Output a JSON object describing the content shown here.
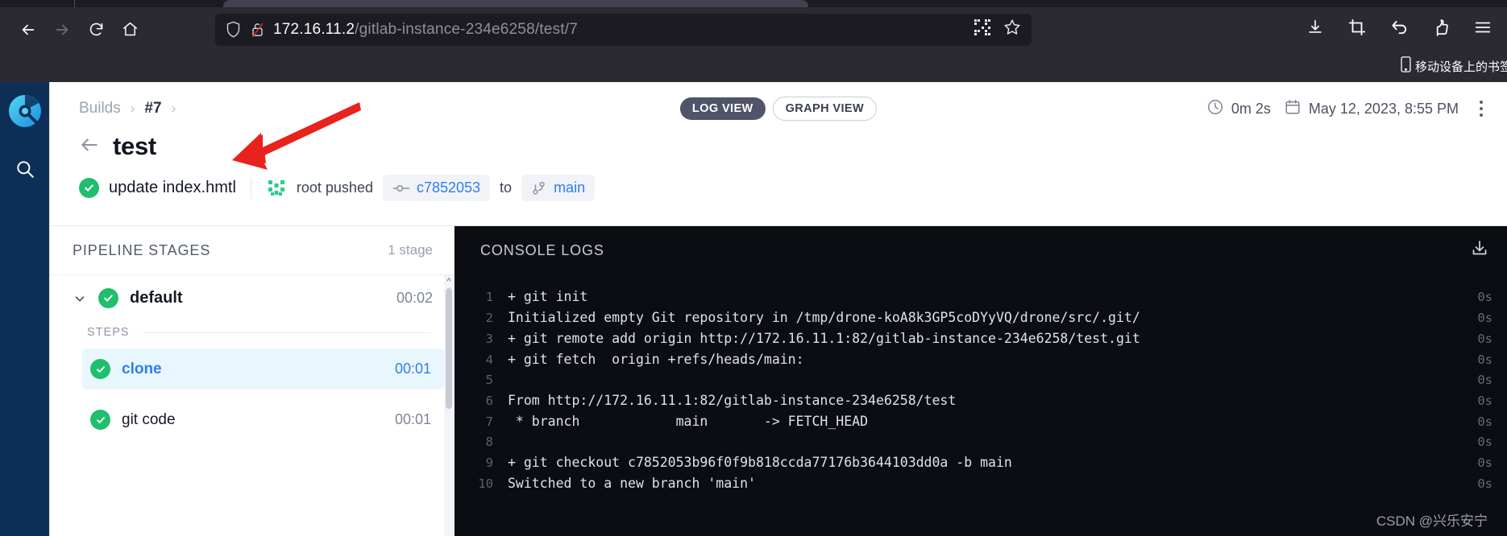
{
  "browser": {
    "nav": {
      "back_icon": "arrow-left-icon",
      "forward_icon": "arrow-right-icon",
      "reload_icon": "reload-icon",
      "home_icon": "home-icon"
    },
    "address_bar": {
      "shield_icon": "shield-icon",
      "lock_icon": "broken-lock-icon",
      "url_host": "172.16.11.2",
      "url_path": "/gitlab-instance-234e6258/test/7",
      "qr_icon": "qr-code-icon",
      "bookmark_icon": "star-icon"
    },
    "toolbar_icons": [
      "download-icon",
      "screenshot-crop-icon",
      "undo-arrow-icon",
      "pocket-icon",
      "hamburger-menu-icon"
    ],
    "bookmarks_bar": {
      "item_label": "移动设备上的书签",
      "item_icon": "mobile-device-icon"
    }
  },
  "sidebar": {
    "logo_name": "drone-logo",
    "search_icon": "search-icon"
  },
  "header": {
    "breadcrumb": {
      "root": "Builds",
      "chevron1": "›",
      "build": "#7",
      "chevron2": "›"
    },
    "back_icon": "arrow-left-icon",
    "title": "test",
    "commit": {
      "status_icon": "check-circle-icon",
      "message": "update index.hmtl",
      "avatar_name": "user-avatar",
      "author_text": "root pushed",
      "commit_icon": "commit-node-icon",
      "commit_sha": "c7852053",
      "to_label": "to",
      "branch_icon": "branch-icon",
      "branch_name": "main"
    },
    "view_toggle": {
      "log_view": "LOG VIEW",
      "graph_view": "GRAPH VIEW",
      "active": "LOG VIEW"
    },
    "meta": {
      "clock_icon": "clock-icon",
      "duration": "0m 2s",
      "calendar_icon": "calendar-icon",
      "timestamp": "May 12, 2023, 8:55 PM",
      "menu_icon": "kebab-menu-icon"
    }
  },
  "stages_panel": {
    "title": "PIPELINE STAGES",
    "count": "1 stage",
    "stage": {
      "chevron_icon": "chevron-down-icon",
      "status_icon": "check-circle-icon",
      "name": "default",
      "duration": "00:02"
    },
    "steps_label": "STEPS",
    "steps": [
      {
        "status_icon": "check-circle-icon",
        "name": "clone",
        "duration": "00:01",
        "selected": true
      },
      {
        "status_icon": "check-circle-icon",
        "name": "git code",
        "duration": "00:01",
        "selected": false
      }
    ],
    "scroll_up_icon": "chevron-up-icon"
  },
  "logs_panel": {
    "title": "CONSOLE LOGS",
    "download_icon": "download-icon",
    "lines": [
      {
        "n": "1",
        "text": "+ git init",
        "ts": "0s"
      },
      {
        "n": "2",
        "text": "Initialized empty Git repository in /tmp/drone-koA8k3GP5coDYyVQ/drone/src/.git/",
        "ts": "0s"
      },
      {
        "n": "3",
        "text": "+ git remote add origin http://172.16.11.1:82/gitlab-instance-234e6258/test.git",
        "ts": "0s"
      },
      {
        "n": "4",
        "text": "+ git fetch  origin +refs/heads/main:",
        "ts": "0s"
      },
      {
        "n": "5",
        "text": "",
        "ts": "0s"
      },
      {
        "n": "6",
        "text": "From http://172.16.11.1:82/gitlab-instance-234e6258/test",
        "ts": "0s"
      },
      {
        "n": "7",
        "text": " * branch            main       -> FETCH_HEAD",
        "ts": "0s"
      },
      {
        "n": "8",
        "text": "",
        "ts": "0s"
      },
      {
        "n": "9",
        "text": "+ git checkout c7852053b96f0f9b818ccda77176b3644103dd0a -b main",
        "ts": "0s"
      },
      {
        "n": "10",
        "text": "Switched to a new branch 'main'",
        "ts": "0s"
      }
    ]
  },
  "watermark": "CSDN @兴乐安宁",
  "colors": {
    "accent_blue": "#2f7ef3",
    "success_green": "#1fbf6d",
    "sidebar_navy": "#0d2f57",
    "log_bg": "#0b0d12",
    "chrome_bg": "#2b2a33",
    "annotation_red": "#e8231e"
  }
}
